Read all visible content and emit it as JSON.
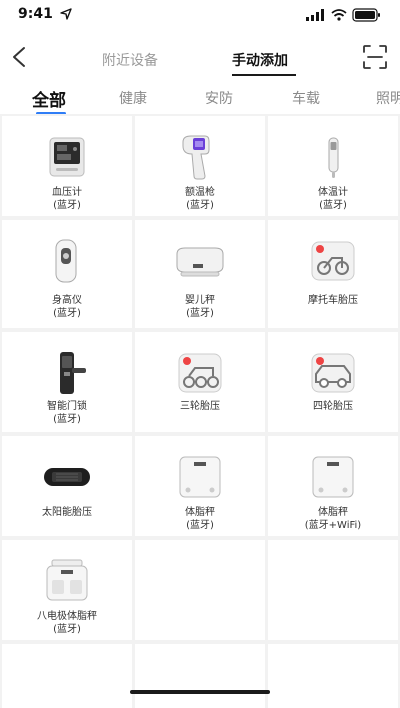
{
  "status": {
    "time": "9:41"
  },
  "nav": {
    "tabs": [
      {
        "label": "附近设备",
        "active": false
      },
      {
        "label": "手动添加",
        "active": true
      }
    ]
  },
  "categories": [
    {
      "label": "全部",
      "active": true
    },
    {
      "label": "健康",
      "active": false
    },
    {
      "label": "安防",
      "active": false
    },
    {
      "label": "车载",
      "active": false
    },
    {
      "label": "照明",
      "active": false
    }
  ],
  "devices": [
    {
      "name": "血压计",
      "sub": "(蓝牙)",
      "icon": "blood-pressure-monitor-icon"
    },
    {
      "name": "额温枪",
      "sub": "(蓝牙)",
      "icon": "forehead-thermometer-icon"
    },
    {
      "name": "体温计",
      "sub": "(蓝牙)",
      "icon": "thermometer-icon"
    },
    {
      "name": "身高仪",
      "sub": "(蓝牙)",
      "icon": "height-meter-icon"
    },
    {
      "name": "婴儿秤",
      "sub": "(蓝牙)",
      "icon": "baby-scale-icon"
    },
    {
      "name": "摩托车胎压",
      "sub": "",
      "icon": "motorcycle-tire-pressure-icon"
    },
    {
      "name": "智能门锁",
      "sub": "(蓝牙)",
      "icon": "smart-door-lock-icon"
    },
    {
      "name": "三轮胎压",
      "sub": "",
      "icon": "tricycle-tire-pressure-icon"
    },
    {
      "name": "四轮胎压",
      "sub": "",
      "icon": "car-tire-pressure-icon"
    },
    {
      "name": "太阳能胎压",
      "sub": "",
      "icon": "solar-tire-pressure-icon"
    },
    {
      "name": "体脂秤",
      "sub": "(蓝牙)",
      "icon": "body-fat-scale-icon"
    },
    {
      "name": "体脂秤",
      "sub": "(蓝牙+WiFi)",
      "icon": "body-fat-scale-wifi-icon"
    },
    {
      "name": "八电极体脂秤",
      "sub": "(蓝牙)",
      "icon": "eight-electrode-scale-icon"
    }
  ]
}
